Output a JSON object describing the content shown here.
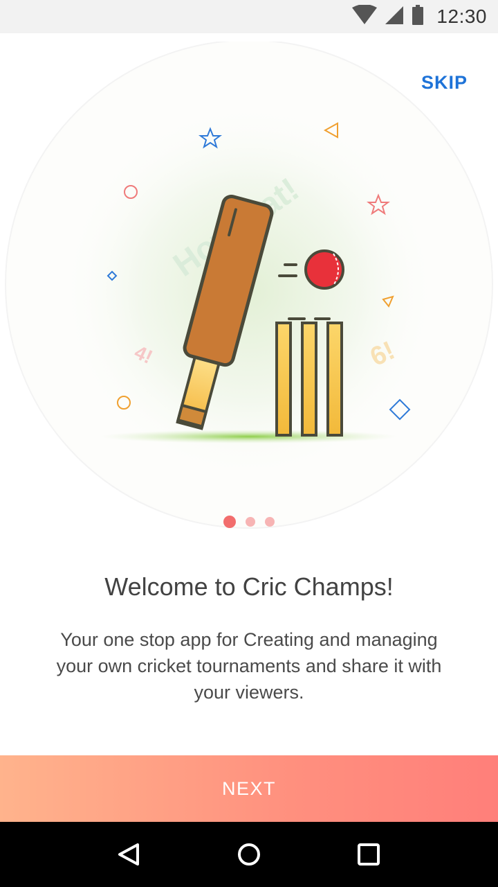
{
  "status_bar": {
    "time": "12:30"
  },
  "onboarding": {
    "skip_label": "SKIP",
    "illustration": {
      "text_howzzat": "Howzzat!",
      "text_four": "4!",
      "text_six": "6!"
    },
    "page_indicator": {
      "current": 1,
      "total": 3
    },
    "title": "Welcome to Cric Champs!",
    "description": "Your one stop app for Creating and managing your own cricket tournaments and share it with your viewers.",
    "next_label": "NEXT"
  },
  "colors": {
    "accent_blue": "#1e73d8",
    "button_gradient_start": "#ffb38c",
    "button_gradient_end": "#ff7f7a",
    "dot_active": "#f26d6d",
    "dot_inactive": "#f7b4b4"
  },
  "nav_bar": {
    "icons": [
      "back-icon",
      "home-icon",
      "recents-icon"
    ]
  }
}
